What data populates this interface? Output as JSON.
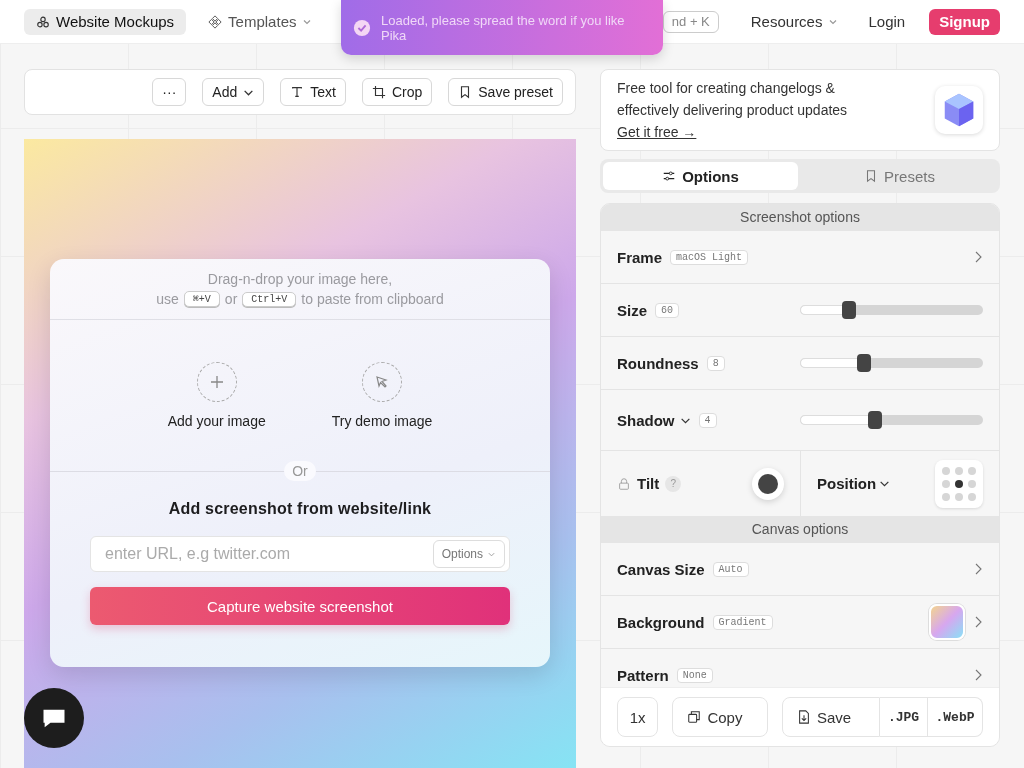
{
  "nav": {
    "items": [
      {
        "label": "Website Mockups",
        "selected": true,
        "kind": "icon"
      },
      {
        "label": "Templates",
        "selected": false,
        "kind": "menu"
      }
    ],
    "search_shortcut": "nd + K",
    "right": [
      {
        "label": "Resources",
        "kind": "menu"
      },
      {
        "label": "Login",
        "kind": "link"
      },
      {
        "label": "Signup",
        "kind": "cta"
      }
    ]
  },
  "toast": {
    "message": "Loaded, please spread the word if you like Pika"
  },
  "toolbar": {
    "more": "···",
    "buttons": [
      {
        "label": "Add",
        "kind": "dropdown"
      },
      {
        "label": "Text",
        "kind": "text"
      },
      {
        "label": "Crop",
        "kind": "crop"
      },
      {
        "label": "Save preset",
        "kind": "preset"
      }
    ]
  },
  "dropzone": {
    "hint_line1": "Drag-n-drop your image here,",
    "hint_use": "use",
    "key_mac": "⌘+V",
    "hint_or": "or",
    "key_pc": "Ctrl+V",
    "hint_rest": "to paste from clipboard",
    "actions": [
      {
        "label": "Add your image",
        "kind": "add"
      },
      {
        "label": "Try demo image",
        "kind": "demo"
      }
    ],
    "divider": "Or",
    "url_title": "Add screenshot from website/link",
    "url_placeholder": "enter URL, e.g twitter.com",
    "options_button": "Options",
    "capture_button": "Capture website screenshot"
  },
  "promo": {
    "text": "Free tool for creating changelogs & effectively delivering product updates",
    "link": "Get it free →"
  },
  "tabs": [
    {
      "label": "Options",
      "selected": true,
      "kind": "options"
    },
    {
      "label": "Presets",
      "selected": false,
      "kind": "presets"
    }
  ],
  "screenshot_options": {
    "title": "Screenshot options",
    "rows": [
      {
        "kind": "select",
        "label": "Frame",
        "badge": "macOS Light"
      },
      {
        "kind": "slider",
        "label": "Size",
        "badge": "60",
        "level": 0.27
      },
      {
        "kind": "slider",
        "label": "Roundness",
        "badge": "8",
        "level": 0.35
      },
      {
        "kind": "slider",
        "label": "Shadow",
        "badge": "4",
        "level": 0.41,
        "dropdown": true
      }
    ]
  },
  "tilt": {
    "label": "Tilt",
    "help": "?",
    "locked": true
  },
  "position": {
    "label": "Position",
    "grid": [
      {
        "selected": false
      },
      {
        "selected": false
      },
      {
        "selected": false
      },
      {
        "selected": false
      },
      {
        "selected": true
      },
      {
        "selected": false
      },
      {
        "selected": false
      },
      {
        "selected": false
      },
      {
        "selected": false
      }
    ]
  },
  "canvas_options": {
    "title": "Canvas options",
    "rows": [
      {
        "kind": "select",
        "label": "Canvas Size",
        "badge": "Auto"
      },
      {
        "kind": "swatch",
        "label": "Background",
        "badge": "Gradient"
      },
      {
        "kind": "select",
        "label": "Pattern",
        "badge": "None"
      }
    ]
  },
  "export": {
    "scale": "1x",
    "copy": "Copy",
    "save": "Save",
    "formats": [
      ".JPG",
      ".WebP"
    ]
  }
}
